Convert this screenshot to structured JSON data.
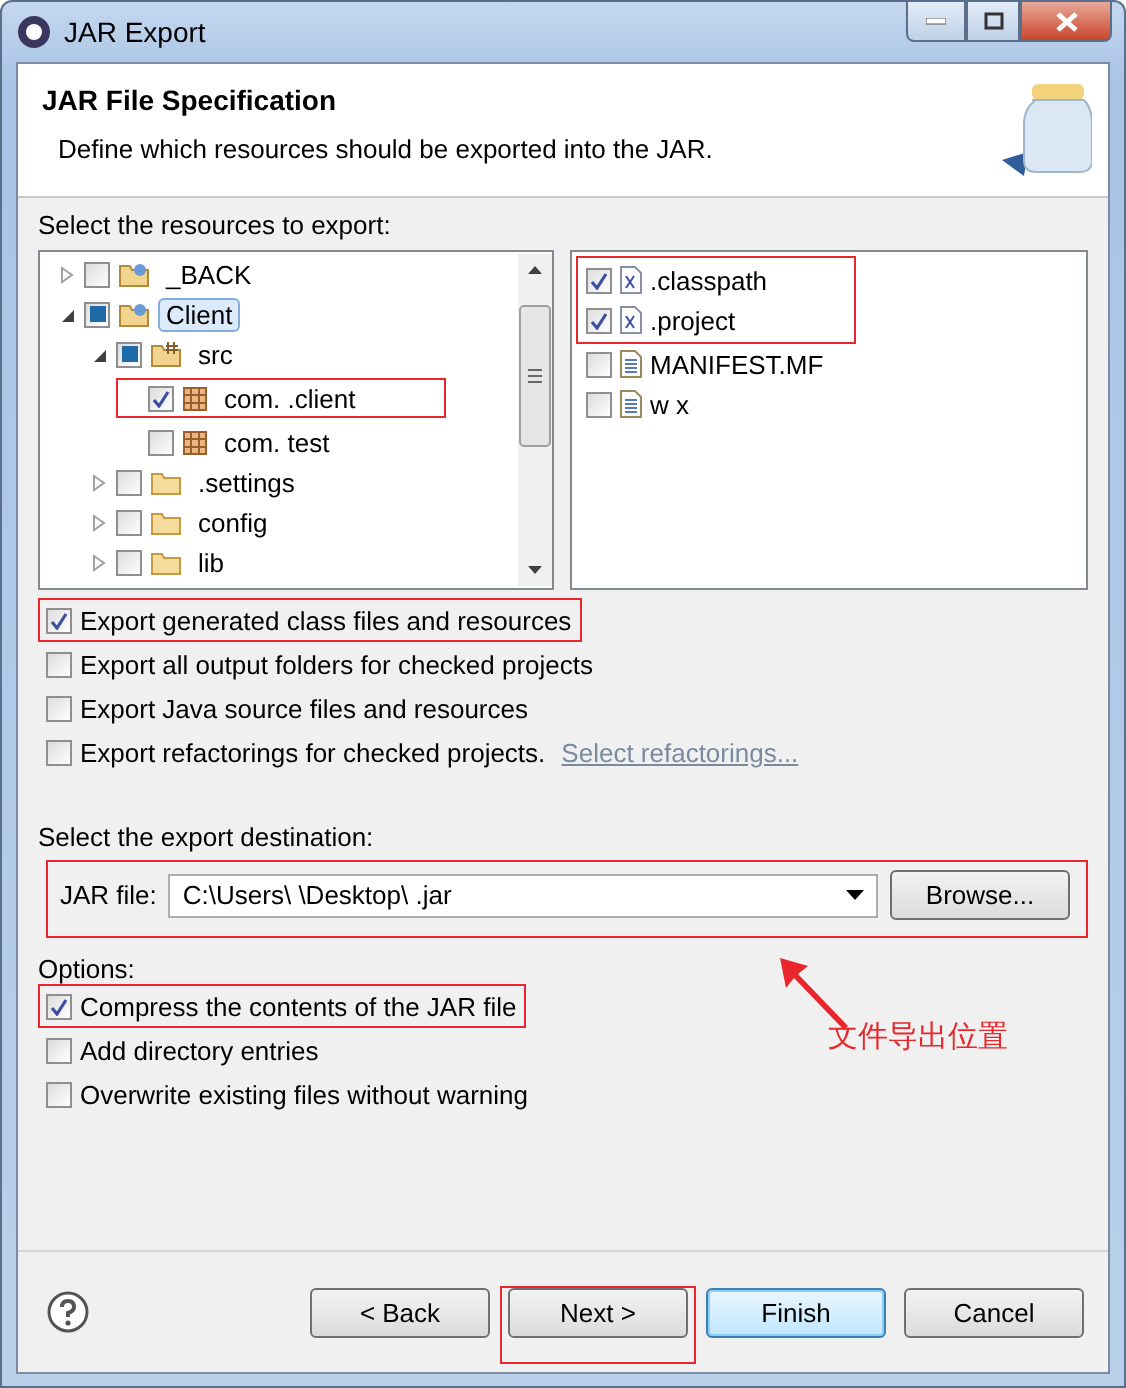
{
  "window": {
    "title": "JAR Export"
  },
  "header": {
    "title": "JAR File Specification",
    "description": "Define which resources should be exported into the JAR."
  },
  "resources": {
    "label": "Select the resources to export:",
    "tree": [
      {
        "label": "_BACK",
        "expanded": false,
        "checked": false,
        "partial": false,
        "selected": false,
        "highlighted": false,
        "kind": "project"
      },
      {
        "label": "Client",
        "expanded": true,
        "checked": false,
        "partial": true,
        "selected": true,
        "highlighted": false,
        "kind": "project",
        "children": [
          {
            "label": "src",
            "expanded": true,
            "checked": false,
            "partial": true,
            "selected": false,
            "highlighted": false,
            "kind": "source",
            "children": [
              {
                "label": "com. .client",
                "checked": true,
                "selected": false,
                "highlighted": true,
                "kind": "package"
              },
              {
                "label": "com. test",
                "checked": false,
                "selected": false,
                "highlighted": false,
                "kind": "package"
              }
            ]
          },
          {
            "label": ".settings",
            "expanded": false,
            "checked": false,
            "partial": false,
            "selected": false,
            "highlighted": false,
            "kind": "folder"
          },
          {
            "label": "config",
            "expanded": false,
            "checked": false,
            "partial": false,
            "selected": false,
            "highlighted": false,
            "kind": "folder"
          },
          {
            "label": "lib",
            "expanded": false,
            "checked": false,
            "partial": false,
            "selected": false,
            "highlighted": false,
            "kind": "folder"
          }
        ]
      }
    ],
    "files": [
      {
        "label": ".classpath",
        "checked": true,
        "kind": "xml",
        "highlighted": true
      },
      {
        "label": ".project",
        "checked": true,
        "kind": "xml",
        "highlighted": true
      },
      {
        "label": "MANIFEST.MF",
        "checked": false,
        "kind": "text",
        "highlighted": false
      },
      {
        "label": "w x",
        "checked": false,
        "kind": "text",
        "highlighted": false
      }
    ]
  },
  "export_options": [
    {
      "label": "Export generated class files and resources",
      "checked": true,
      "highlighted": true
    },
    {
      "label": "Export all output folders for checked projects",
      "checked": false,
      "highlighted": false
    },
    {
      "label": "Export Java source files and resources",
      "checked": false,
      "highlighted": false
    },
    {
      "label": "Export refactorings for checked projects.",
      "checked": false,
      "highlighted": false,
      "link": "Select refactorings..."
    }
  ],
  "destination": {
    "label": "Select the export destination:",
    "field_label": "JAR file:",
    "value": "C:\\Users\\ \\Desktop\\ .jar",
    "browse": "Browse...",
    "highlighted": true
  },
  "options": {
    "label": "Options:",
    "items": [
      {
        "label": "Compress the contents of the JAR file",
        "checked": true,
        "highlighted": true
      },
      {
        "label": "Add directory entries",
        "checked": false,
        "highlighted": false
      },
      {
        "label": "Overwrite existing files without warning",
        "checked": false,
        "highlighted": false
      }
    ]
  },
  "annotation": "文件导出位置",
  "buttons": [
    {
      "label": "< Back",
      "default": false,
      "highlighted": false
    },
    {
      "label": "Next >",
      "default": false,
      "highlighted": true
    },
    {
      "label": "Finish",
      "default": true,
      "highlighted": false
    },
    {
      "label": "Cancel",
      "default": false,
      "highlighted": false
    }
  ]
}
